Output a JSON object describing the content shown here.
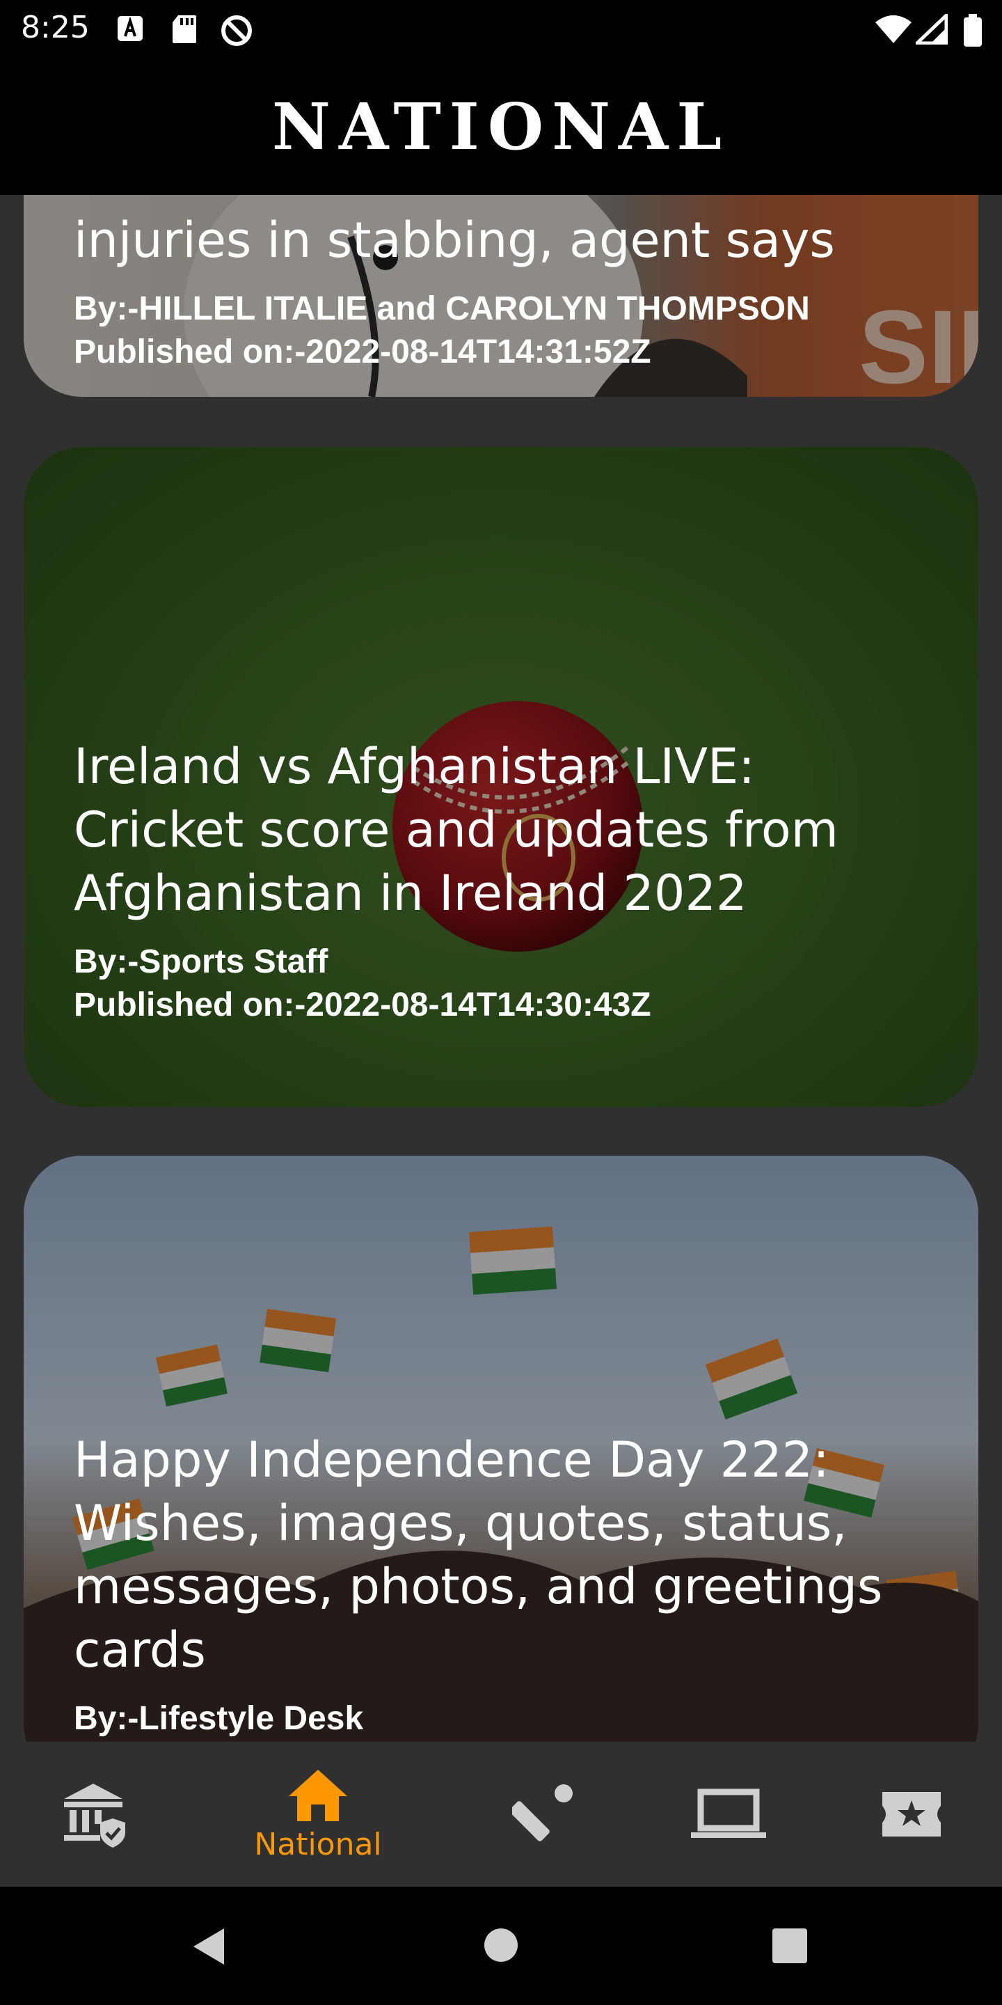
{
  "status": {
    "time": "8:25"
  },
  "appbar": {
    "title": "NATIONAL"
  },
  "articles": [
    {
      "headline": "injuries in stabbing, agent says",
      "author": "By:-HILLEL ITALIE and CAROLYN THOMPSON",
      "published": "Published on:-2022-08-14T14:31:52Z"
    },
    {
      "headline": "Ireland vs Afghanistan LIVE: Cricket score and updates from Afghanistan in Ireland 2022",
      "author": "By:-Sports Staff",
      "published": "Published on:-2022-08-14T14:30:43Z"
    },
    {
      "headline": "Happy Independence Day 222: Wishes, images, quotes, status, messages, photos, and greetings cards",
      "author": "By:-Lifestyle Desk"
    }
  ],
  "bottom_nav": {
    "active_label": "National",
    "items": [
      {
        "icon": "bank-shield-icon"
      },
      {
        "icon": "home-icon",
        "label": "National"
      },
      {
        "icon": "cricket-icon"
      },
      {
        "icon": "laptop-icon"
      },
      {
        "icon": "ticket-star-icon"
      }
    ]
  },
  "colors": {
    "accent": "#ff9800",
    "background": "#303030",
    "bar": "#000000"
  }
}
